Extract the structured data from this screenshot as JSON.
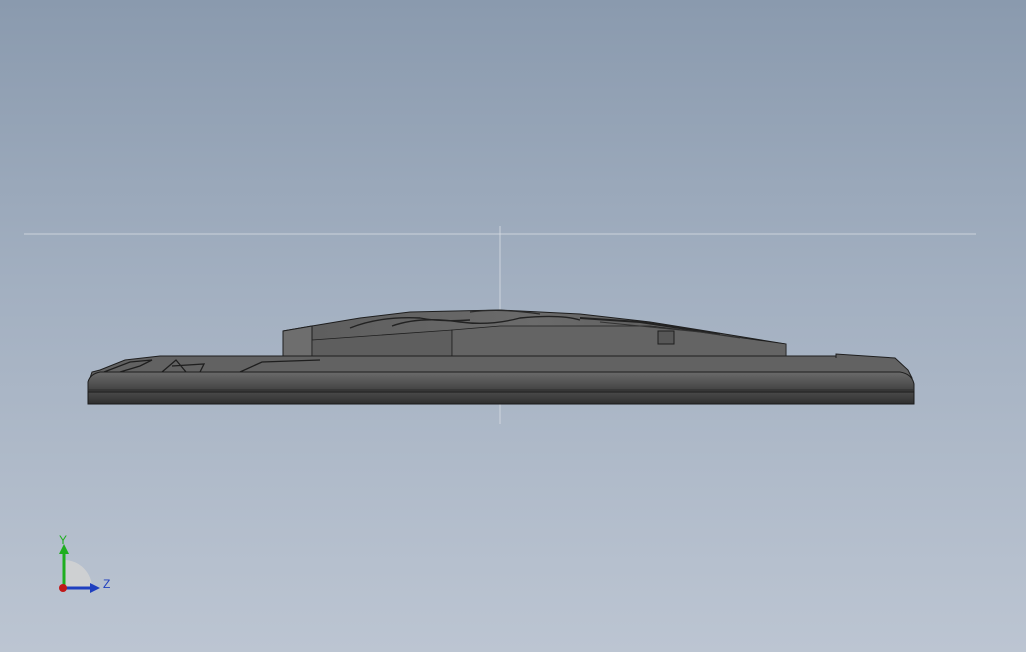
{
  "viewport": {
    "background_top": "#8a9aae",
    "background_bottom": "#bcc5d2"
  },
  "model": {
    "body_color": "#5a5a5a",
    "edge_color": "#1e1e1e"
  },
  "triad": {
    "y_label": "Y",
    "z_label": "Z",
    "y_color": "#1fae1f",
    "z_color": "#1f3fbf",
    "x_color": "#c01818",
    "y_icon": "y-axis-arrow-icon",
    "z_icon": "z-axis-arrow-icon",
    "x_icon": "x-axis-origin-icon"
  }
}
